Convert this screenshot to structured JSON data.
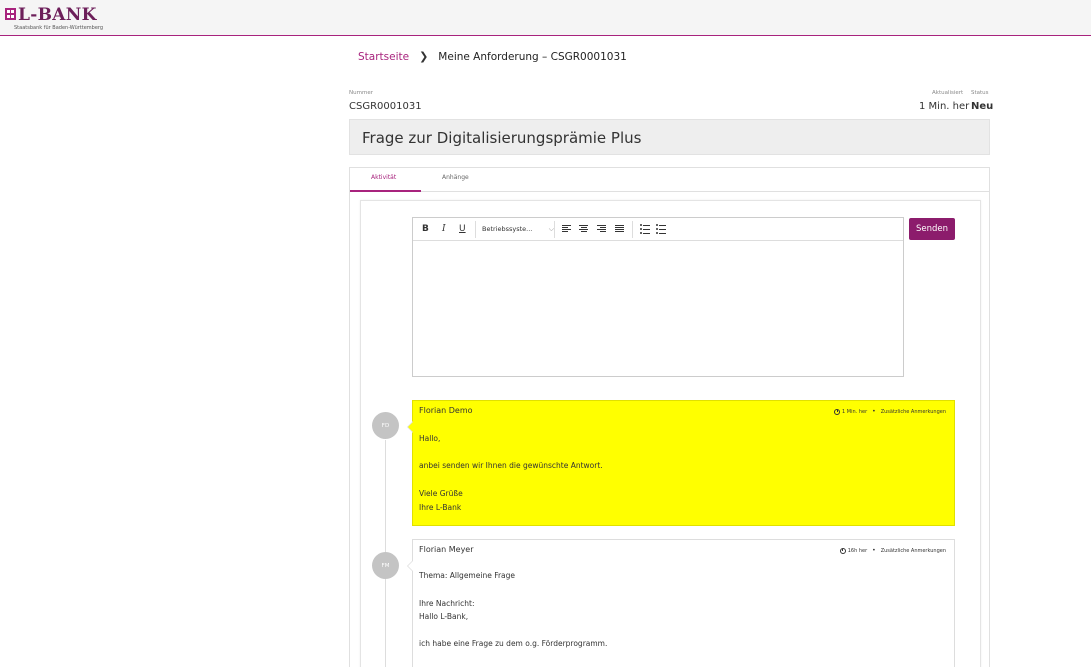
{
  "header": {
    "logo_name": "L-BANK",
    "logo_subtitle": "Staatsbank für Baden-Württemberg",
    "accent_color": "#a8237d"
  },
  "breadcrumb": {
    "home": "Startseite",
    "current": "Meine Anforderung – CSGR0001031"
  },
  "meta": {
    "number_label": "Nummer",
    "number_value": "CSGR0001031",
    "updated_label": "Aktualisiert",
    "updated_value": "1 Min. her",
    "status_label": "Status",
    "status_value": "Neu"
  },
  "title": "Frage zur Digitalisierungsprämie Plus",
  "tabs": [
    {
      "label": "Aktivität"
    },
    {
      "label": "Anhänge"
    }
  ],
  "editor": {
    "bold": "B",
    "italic": "I",
    "underline": "U",
    "font_family": "Betriebssyste...",
    "send_label": "Senden"
  },
  "messages": [
    {
      "initials": "FD",
      "author": "Florian Demo",
      "time": "1 Min. her",
      "extra": "Zusätzliche Anmerkungen",
      "lines": [
        "Hallo,",
        "",
        "anbei senden wir Ihnen die gewünschte Antwort.",
        "",
        "Viele Grüße",
        "Ihre L-Bank"
      ]
    },
    {
      "initials": "FM",
      "author": "Florian Meyer",
      "time": "16h her",
      "extra": "Zusätzliche Anmerkungen",
      "lines": [
        "Thema: Allgemeine Frage",
        "",
        "Ihre Nachricht:",
        "Hallo L-Bank,",
        "",
        "ich habe eine Frage zu dem o.g. Förderprogramm."
      ]
    }
  ]
}
